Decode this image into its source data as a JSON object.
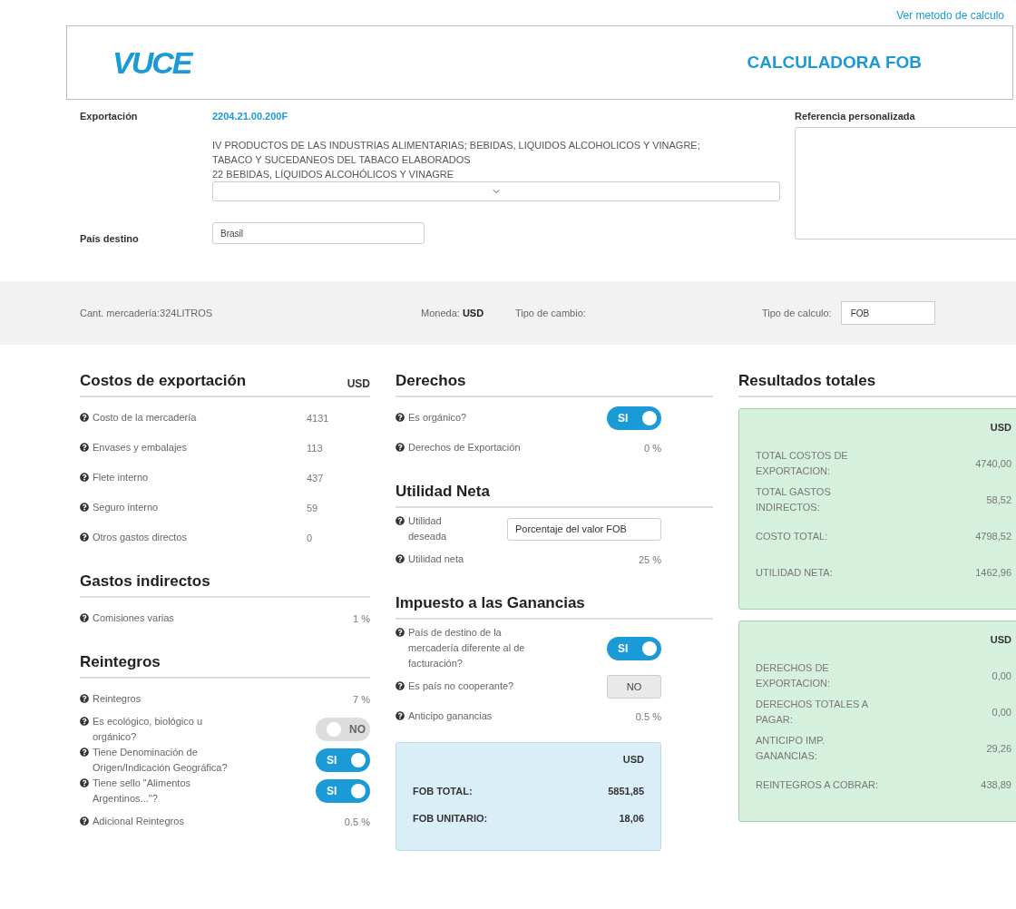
{
  "top_link": "Ver metodo de calculo",
  "header": {
    "logo": "VUCE",
    "title": "CALCULADORA FOB"
  },
  "form": {
    "export_label": "Exportación",
    "export_code": "2204.21.00.200F",
    "description": [
      "IV PRODUCTOS DE LAS INDUSTRIAS ALIMENTARIAS; BEBIDAS, LIQUIDOS ALCOHOLICOS Y VINAGRE;",
      "TABACO Y SUCEDANEOS DEL TABACO ELABORADOS",
      "22 BEBIDAS, LÍQUIDOS ALCOHÓLICOS Y VINAGRE"
    ],
    "country_label": "País destino",
    "country_value": "Brasil",
    "reference_label": "Referencia personalizada"
  },
  "summary_bar": {
    "quantity": "Cant. mercadería:324LITROS",
    "currency_label": "Moneda:",
    "currency": "USD",
    "exchange_label": "Tipo de cambio:",
    "calc_label": "Tipo de calculo:",
    "calc_value": "FOB"
  },
  "columns": [
    {
      "sections": [
        {
          "title": "Costos de exportación",
          "unit": "USD",
          "rows": [
            {
              "kind": "amount",
              "label": "Costo de la mercadería",
              "value": "4131"
            },
            {
              "kind": "amount",
              "label": "Envases y embalajes",
              "value": "113"
            },
            {
              "kind": "amount",
              "label": "Flete interno",
              "value": "437"
            },
            {
              "kind": "amount",
              "label": "Seguro interno",
              "value": "59"
            },
            {
              "kind": "amount",
              "label": "Otros gastos directos",
              "value": "0"
            }
          ]
        },
        {
          "title": "Gastos indirectos",
          "rows": [
            {
              "kind": "percent",
              "label": "Comisiones varias",
              "value": "1 %"
            }
          ]
        },
        {
          "title": "Reintegros",
          "rows": [
            {
              "kind": "percent",
              "label": "Reintegros",
              "value": "7 %"
            },
            {
              "kind": "toggle",
              "label": "Es ecológico, biológico u orgánico?",
              "on": false,
              "value": "NO"
            },
            {
              "kind": "toggle",
              "label": "Tiene Denominación de Origen/Indicación Geográfica?",
              "on": true,
              "value": "SI"
            },
            {
              "kind": "toggle",
              "label": "Tiene sello \"Alimentos Argentinos...\"?",
              "on": true,
              "value": "SI"
            },
            {
              "kind": "percent",
              "label": "Adicional Reintegros",
              "value": "0.5 %"
            }
          ]
        }
      ]
    },
    {
      "sections": [
        {
          "title": "Derechos",
          "rows": [
            {
              "kind": "toggle",
              "label": "Es orgánico?",
              "on": true,
              "value": "SI"
            },
            {
              "kind": "percent",
              "label": "Derechos de Exportación",
              "value": "0 %"
            }
          ]
        },
        {
          "title": "Utilidad Neta",
          "rows": [
            {
              "kind": "select",
              "label": "Utilidad deseada",
              "value": "Porcentaje del valor FOB"
            },
            {
              "kind": "percent",
              "label": "Utilidad neta",
              "value": "25 %"
            }
          ]
        },
        {
          "title": "Impuesto a las Ganancias",
          "rows": [
            {
              "kind": "toggle",
              "label": "País de destino de la mercadería diferente al de facturación?",
              "on": true,
              "value": "SI"
            },
            {
              "kind": "button",
              "label": "Es país no cooperante?",
              "value": "NO"
            },
            {
              "kind": "percent",
              "label": "Anticipo ganancias",
              "value": "0.5 %"
            }
          ]
        }
      ],
      "totals": {
        "unit": "USD",
        "rows": [
          {
            "label": "FOB TOTAL:",
            "value": "5851,85"
          },
          {
            "label": "FOB UNITARIO:",
            "value": "18,06"
          }
        ]
      }
    },
    {
      "sections": [
        {
          "title": "Resultados totales"
        }
      ],
      "results": [
        {
          "unit": "USD",
          "rows": [
            {
              "label": "TOTAL COSTOS DE EXPORTACION:",
              "value": "4740,00"
            },
            {
              "label": "TOTAL GASTOS INDIRECTOS:",
              "value": "58,52"
            },
            {
              "label": "COSTO TOTAL:",
              "value": "4798,52"
            },
            {
              "label": "UTILIDAD NETA:",
              "value": "1462,96"
            }
          ]
        },
        {
          "unit": "USD",
          "rows": [
            {
              "label": "DERECHOS DE EXPORTACION:",
              "value": "0,00"
            },
            {
              "label": "DERECHOS TOTALES A PAGAR:",
              "value": "0,00"
            },
            {
              "label": "ANTICIPO IMP. GANANCIAS:",
              "value": "29,26"
            },
            {
              "label": "REINTEGROS A COBRAR:",
              "value": "438,89"
            }
          ]
        }
      ]
    }
  ]
}
